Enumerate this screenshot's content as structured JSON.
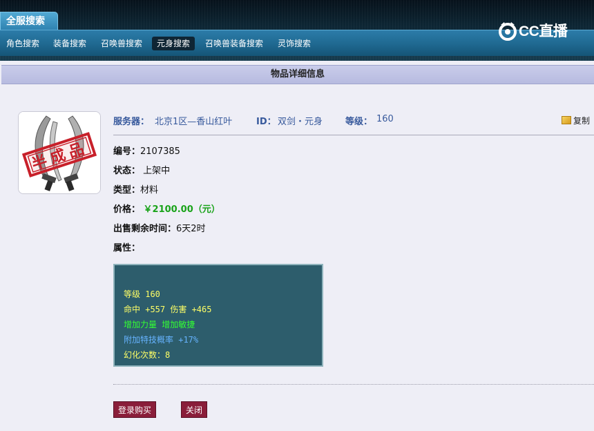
{
  "topbar": {
    "main_tab": "全服搜索",
    "nav": [
      "角色搜索",
      "装备搜索",
      "召唤兽搜索",
      "元身搜索",
      "召唤兽装备搜索",
      "灵饰搜索"
    ],
    "active_nav": "元身搜索",
    "logo_text": "CC直播"
  },
  "header": {
    "title": "物品详细信息"
  },
  "item": {
    "image_stamp_text": "半成品",
    "server_label": "服务器：",
    "server_value": "北京1区—香山红叶",
    "id_label": "ID：",
    "id_value": "双剑・元身",
    "level_label": "等级：",
    "level_value": "160",
    "copy_label": "复制",
    "fields": [
      {
        "key": "编号：",
        "value": "2107385"
      },
      {
        "key": "状态：",
        "value": " 上架中"
      },
      {
        "key": "类型：",
        "value": "材料"
      },
      {
        "key": "价格：",
        "value": " ￥2100.00（元）"
      },
      {
        "key": "出售剩余时间：",
        "value": "6天2时"
      },
      {
        "key": "属性：",
        "value": ""
      }
    ]
  },
  "attributes": {
    "lines": [
      "等级 160",
      "命中 +557 伤害 +465",
      "增加力量 增加敏捷",
      "附加特技概率 +17%",
      "幻化次数：8"
    ]
  },
  "buttons": {
    "login_buy": "登录购买",
    "close": "关闭"
  },
  "colors": {
    "price": "#1aa31a",
    "attr_yellow": "#ffff66",
    "attr_green": "#33ff33",
    "attr_blue": "#66b3ff",
    "button": "#8a1e3a",
    "header_band": "#c9ccea"
  }
}
